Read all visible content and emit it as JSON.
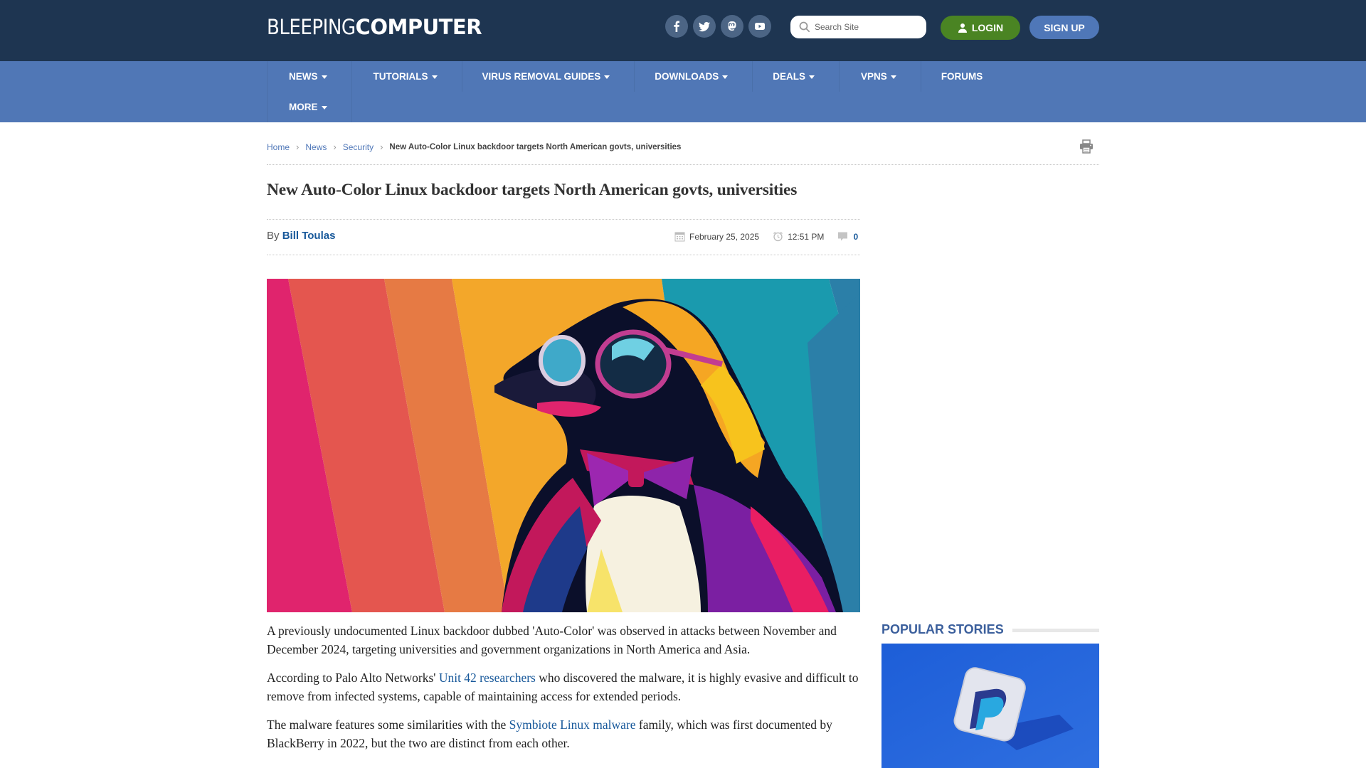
{
  "header": {
    "logo_light": "BLEEPING",
    "logo_bold": "COMPUTER",
    "socials": [
      {
        "name": "facebook",
        "icon": "facebook-icon"
      },
      {
        "name": "twitter",
        "icon": "twitter-icon"
      },
      {
        "name": "mastodon",
        "icon": "mastodon-icon"
      },
      {
        "name": "youtube",
        "icon": "youtube-icon"
      }
    ],
    "search_placeholder": "Search Site",
    "search_value": "",
    "login_label": "LOGIN",
    "signup_label": "SIGN UP",
    "colors": {
      "topbar": "#1e3551",
      "login": "#4a8423",
      "signup": "#4f77b8"
    }
  },
  "nav": {
    "items": [
      {
        "label": "NEWS",
        "dropdown": true
      },
      {
        "label": "TUTORIALS",
        "dropdown": true
      },
      {
        "label": "VIRUS REMOVAL GUIDES",
        "dropdown": true
      },
      {
        "label": "DOWNLOADS",
        "dropdown": true
      },
      {
        "label": "DEALS",
        "dropdown": true
      },
      {
        "label": "VPNS",
        "dropdown": true
      },
      {
        "label": "FORUMS",
        "dropdown": false
      },
      {
        "label": "MORE",
        "dropdown": true
      }
    ],
    "color": "#5077b6"
  },
  "breadcrumb": {
    "items": [
      "Home",
      "News",
      "Security"
    ],
    "current": "New Auto-Color Linux backdoor targets North American govts, universities"
  },
  "article": {
    "title": "New Auto-Color Linux backdoor targets North American govts, universities",
    "by_label": "By",
    "author": "Bill Toulas",
    "date": "February 25, 2025",
    "time": "12:51 PM",
    "comment_count": "0",
    "hero_alt": "Penguin wearing sunglasses and a bow tie on colorful striped background",
    "paragraphs": [
      {
        "parts": [
          {
            "text": "A previously undocumented Linux backdoor dubbed 'Auto-Color' was observed in attacks between November and December 2024, targeting universities and government organizations in North America and Asia.",
            "link": false
          }
        ]
      },
      {
        "parts": [
          {
            "text": "According to Palo Alto Networks' ",
            "link": false
          },
          {
            "text": "Unit 42 researchers",
            "link": true
          },
          {
            "text": " who discovered the malware, it is highly evasive and difficult to remove from infected systems, capable of maintaining access for extended periods.",
            "link": false
          }
        ]
      },
      {
        "parts": [
          {
            "text": "The malware features some similarities with the ",
            "link": false
          },
          {
            "text": "Symbiote Linux malware",
            "link": true
          },
          {
            "text": " family, which was first documented by BlackBerry in 2022, but the two are distinct from each other.",
            "link": false
          }
        ]
      }
    ]
  },
  "sidebar": {
    "popular_heading": "POPULAR STORIES",
    "story_image_alt": "PayPal logo tile on blue background"
  }
}
